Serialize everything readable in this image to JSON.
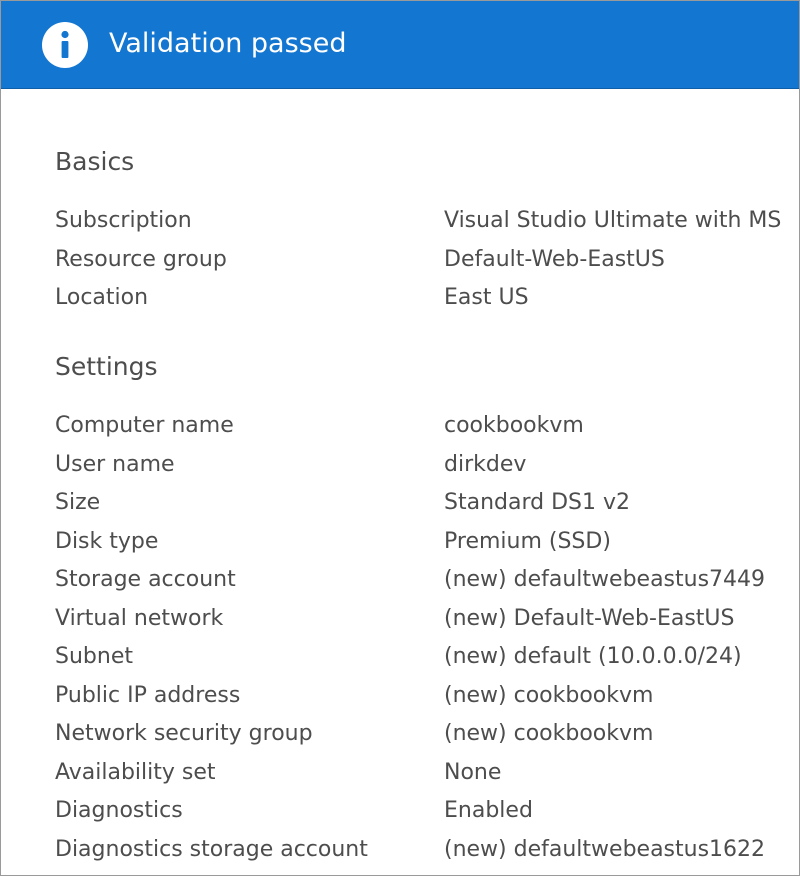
{
  "banner": {
    "title": "Validation passed",
    "icon": "info-icon",
    "color": "#1376d0"
  },
  "sections": {
    "basics": {
      "heading": "Basics",
      "rows": [
        {
          "label": "Subscription",
          "value": "Visual Studio Ultimate with MS"
        },
        {
          "label": "Resource group",
          "value": "Default-Web-EastUS"
        },
        {
          "label": "Location",
          "value": "East US"
        }
      ]
    },
    "settings": {
      "heading": "Settings",
      "rows": [
        {
          "label": "Computer name",
          "value": "cookbookvm"
        },
        {
          "label": "User name",
          "value": "dirkdev"
        },
        {
          "label": "Size",
          "value": "Standard DS1 v2"
        },
        {
          "label": "Disk type",
          "value": "Premium (SSD)"
        },
        {
          "label": "Storage account",
          "value": "(new) defaultwebeastus7449"
        },
        {
          "label": "Virtual network",
          "value": "(new) Default-Web-EastUS"
        },
        {
          "label": "Subnet",
          "value": "(new) default (10.0.0.0/24)"
        },
        {
          "label": "Public IP address",
          "value": "(new) cookbookvm"
        },
        {
          "label": "Network security group",
          "value": "(new) cookbookvm"
        },
        {
          "label": "Availability set",
          "value": "None"
        },
        {
          "label": "Diagnostics",
          "value": "Enabled"
        },
        {
          "label": "Diagnostics storage account",
          "value": "(new) defaultwebeastus1622"
        }
      ]
    }
  }
}
